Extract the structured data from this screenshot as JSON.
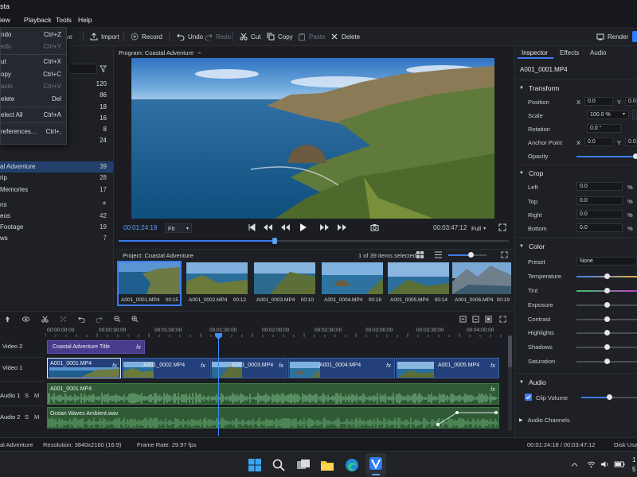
{
  "window": {
    "title": "sta"
  },
  "menubar": {
    "items": [
      "iew",
      "Playback",
      "Tools",
      "Help"
    ]
  },
  "toolbar": {
    "save": "ave",
    "import": "Import",
    "record": "Record",
    "undo": "Undo",
    "redo": "Redo",
    "cut": "Cut",
    "copy": "Copy",
    "paste": "Paste",
    "delete": "Delete",
    "render": "Render"
  },
  "edit_menu": [
    {
      "label": "ndo",
      "shortcut": "Ctrl+Z",
      "enabled": true
    },
    {
      "label": "edo",
      "shortcut": "Ctrl+Y",
      "enabled": false
    },
    {
      "label": "ut",
      "shortcut": "Ctrl+X",
      "enabled": true
    },
    {
      "label": "opy",
      "shortcut": "Ctrl+C",
      "enabled": true
    },
    {
      "label": "aste",
      "shortcut": "Ctrl+V",
      "enabled": false
    },
    {
      "label": "elete",
      "shortcut": "Del",
      "enabled": true
    },
    {
      "label": "elect All",
      "shortcut": "Ctrl+A",
      "enabled": true
    },
    {
      "label": "references...",
      "shortcut": "Ctrl+,",
      "enabled": true
    }
  ],
  "left_panel": {
    "header": "a",
    "counts_top": [
      "120",
      "86",
      "18",
      "16",
      "8",
      "24"
    ],
    "bins": [
      {
        "label": "al Adventure",
        "count": "39",
        "selected": true
      },
      {
        "label": "rip",
        "count": "28",
        "selected": false
      },
      {
        "label": "Memories",
        "count": "17",
        "selected": false
      }
    ],
    "section2": "ns",
    "section2_items": [
      {
        "label": "eos",
        "count": "42"
      },
      {
        "label": "Footage",
        "count": "19"
      },
      {
        "label": "ws",
        "count": "7"
      }
    ]
  },
  "program": {
    "tab_label": "Program: Coastal Adventure",
    "timecode_current": "00:01:24:18",
    "zoom": "Fit",
    "timecode_total": "00:03:47:12",
    "quality": "Full",
    "playhead_fraction": 0.4
  },
  "project_bin": {
    "title": "Project: Coastal Adventure",
    "selection_info": "1 of 39 items selected",
    "thumb_size_fraction": 0.6,
    "clips": [
      {
        "name": "A001_0001.MP4",
        "duration": "00:15",
        "selected": true
      },
      {
        "name": "A001_0002.MP4",
        "duration": "00:12",
        "selected": false
      },
      {
        "name": "A001_0003.MP4",
        "duration": "00:10",
        "selected": false
      },
      {
        "name": "A001_0004.MP4",
        "duration": "00:18",
        "selected": false
      },
      {
        "name": "A001_0005.MP4",
        "duration": "00:14",
        "selected": false
      },
      {
        "name": "A001_0006.MP4",
        "duration": "00:19",
        "selected": false
      }
    ]
  },
  "inspector": {
    "tabs": [
      "Inspector",
      "Effects",
      "Audio"
    ],
    "clip_name": "A001_0001.MP4",
    "transform": {
      "title": "Transform",
      "position_label": "Position",
      "x_label": "X",
      "y_label": "Y",
      "pos_x": "0.0",
      "pos_y": "0.0",
      "scale_label": "Scale",
      "scale": "100.0 %",
      "rotation_label": "Rotation",
      "rotation": "0.0 °",
      "anchor_label": "Anchor Point",
      "anchor_x": "0.0",
      "anchor_y": "0.0",
      "opacity_label": "Opacity",
      "opacity_fraction": 0.98
    },
    "crop": {
      "title": "Crop",
      "unit": "%",
      "rows": [
        {
          "label": "Left",
          "value": "0.0"
        },
        {
          "label": "Top",
          "value": "0.0"
        },
        {
          "label": "Right",
          "value": "0.0"
        },
        {
          "label": "Bottom",
          "value": "0.0"
        }
      ]
    },
    "color": {
      "title": "Color",
      "preset_label": "Preset",
      "preset": "None",
      "sliders": [
        {
          "label": "Temperature",
          "value": 0.5
        },
        {
          "label": "Tint",
          "value": 0.5
        },
        {
          "label": "Exposure",
          "value": 0.5
        },
        {
          "label": "Contrast",
          "value": 0.5
        },
        {
          "label": "Highlights",
          "value": 0.5
        },
        {
          "label": "Shadows",
          "value": 0.5
        },
        {
          "label": "Saturation",
          "value": 0.5
        }
      ]
    },
    "audio": {
      "title": "Audio",
      "clip_volume_label": "Clip Volume",
      "clip_volume_checked": true,
      "clip_volume_fraction": 0.5,
      "channels_label": "Audio Channels"
    }
  },
  "timeline": {
    "ruler": [
      "00:00:00:00",
      "00:00:30:00",
      "00:01:00:00",
      "00:01:30:00",
      "00:02:00:00",
      "00:02:30:00",
      "00:03:00:00",
      "00:03:30:00",
      "00:04:00:00"
    ],
    "tracks": [
      {
        "label": "Video 2"
      },
      {
        "label": "Video 1"
      },
      {
        "label": "Audio 1",
        "s": "S",
        "m": "M"
      },
      {
        "label": "Audio 2",
        "s": "S",
        "m": "M"
      }
    ],
    "title_clip": {
      "name": "Coastal Adventure Title",
      "fx": "fx"
    },
    "video_clips": [
      {
        "name": "A001_0001.MP4",
        "fx": "fx"
      },
      {
        "name": "A001_0002.MP4",
        "fx": "fx"
      },
      {
        "name": "A001_0003.MP4",
        "fx": "fx"
      },
      {
        "name": "A001_0004.MP4",
        "fx": "fx"
      },
      {
        "name": "A001_0005.MP4",
        "fx": "fx"
      }
    ],
    "audio_clips": [
      {
        "name": "A001_0001.MP4",
        "fx": "fx"
      },
      {
        "name": "Ocean Waves Ambient.wav"
      }
    ]
  },
  "statusbar": {
    "project": "al Adventure",
    "resolution": "Resolution: 3840x2160 (16:9)",
    "framerate": "Frame Rate: 29.97 fps",
    "timecode": "00:01:24:18 / 00:03:47:12",
    "disk": "Disk Usag"
  },
  "taskbar": {
    "clock_time": "1",
    "clock_date": "5"
  },
  "colors": {
    "accent": "#3d7cf0",
    "video_clip": "#23407a",
    "title_clip": "#4a3a8c",
    "audio_clip": "#2f5a35",
    "playhead": "#3d8ef5"
  }
}
